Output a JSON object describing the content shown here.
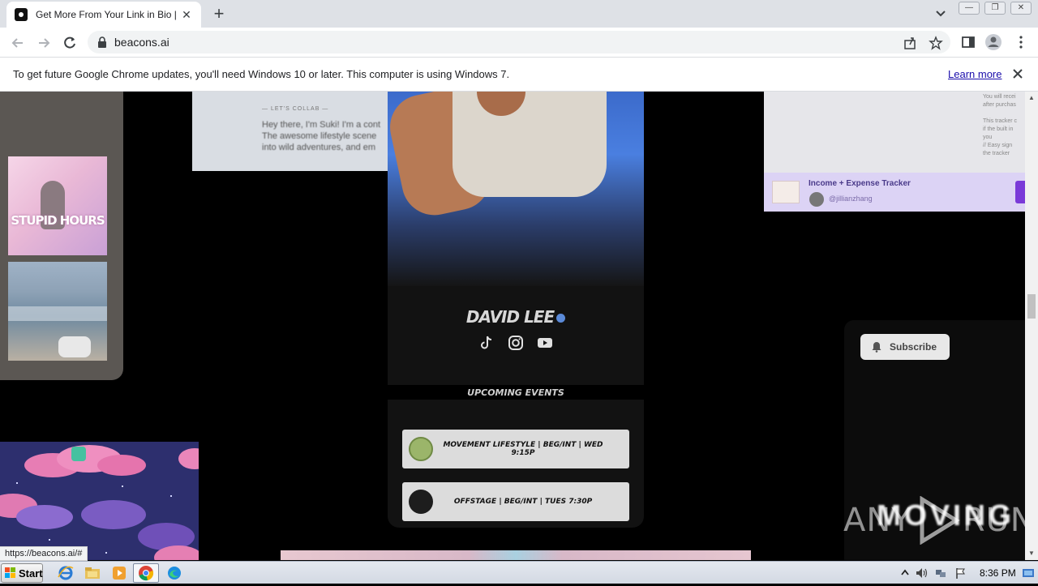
{
  "browser": {
    "tab": {
      "title": "Get More From Your Link in Bio | Bea"
    },
    "url": "beacons.ai",
    "window_buttons": [
      "—",
      "❐",
      "✕"
    ]
  },
  "infobar": {
    "message": "To get future Google Chrome updates, you'll need Windows 10 or later. This computer is using Windows 7.",
    "link": "Learn more"
  },
  "page": {
    "left_photo_text": "STUPID HOURS",
    "bio_card": {
      "eyebrow": "— LET'S COLLAB —",
      "lines": [
        "Hey there, I'm Suki! I'm a cont",
        "The awesome lifestyle scene",
        "into wild adventures, and em"
      ]
    },
    "profile": {
      "name": "DAVID LEE",
      "events_heading": "UPCOMING EVENTS",
      "events": [
        {
          "label": "MOVEMENT LIFESTYLE | BEG/INT | WED 9:15P",
          "thumb_color": "#9bb56a"
        },
        {
          "label": "OFFSTAGE | BEG/INT | TUES 7:30P",
          "thumb_color": "#1d1d1d"
        }
      ]
    },
    "product_card": {
      "side_text": [
        "You will recei",
        "after purchas",
        "",
        "This tracker c",
        "if the built in",
        "you",
        "// Easy sign",
        "the tracker"
      ],
      "title": "Income + Expense Tracker",
      "handle": "@jillianzhang"
    },
    "video_card": {
      "subscribe_label": "Subscribe",
      "overlay_text": "MOVING  H"
    },
    "watermark": {
      "left": "ANY",
      "right": "RUN"
    }
  },
  "status_bar": {
    "url": "https://beacons.ai/#"
  },
  "taskbar": {
    "start_label": "Start",
    "clock": "8:36 PM"
  }
}
